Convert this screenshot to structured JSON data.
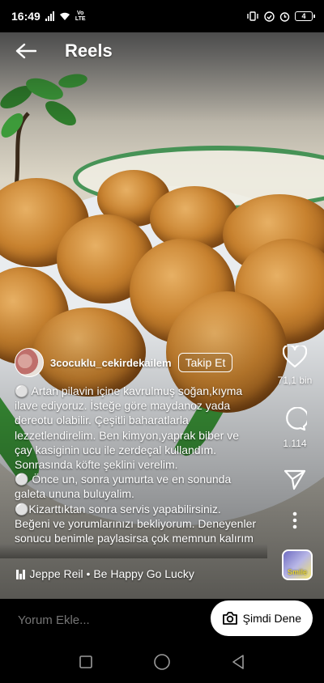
{
  "status_bar": {
    "time": "16:49",
    "volte": "Vo",
    "lte": "LTE",
    "battery": "4"
  },
  "header": {
    "title": "Reels"
  },
  "author": {
    "username": "3cocuklu_cekirdekailem",
    "follow_label": "Takip Et"
  },
  "caption": {
    "lines": [
      "⚪ Artan pilavin içine kavrulmuş soğan,kıyma ilave ediyoruz. İsteğe göre maydanoz yada dereotu olabilir. Çeşitli baharatlarla lezzetlendirelim. Ben kimyon,yaprak biber ve çay kasiginin ucu ile zerdeçal kullandım. Sonrasında köfte şeklini verelim.",
      "⚪ Önce un, sonra yumurta ve en sonunda galeta ununa buluyalim.",
      "⚪Kizarttıktan sonra servis yapabilirsiniz. Beğeni ve yorumlarınızı bekliyorum. Deneyenler sonucu benimle paylasirsa çok memnun kalırım"
    ]
  },
  "actions": {
    "likes": "71,1 bin",
    "comments": "1.114"
  },
  "music": {
    "text": "Jeppe Reil • Be Happy Go Lucky",
    "thumb_label": "Smile"
  },
  "bottom": {
    "comment_placeholder": "Yorum Ekle...",
    "try_label": "Şimdi Dene"
  },
  "colors": {
    "background": "#000000",
    "button_bg": "#ffffff",
    "placeholder": "#a8a8a8",
    "accent_plant": "#3d9b3a"
  }
}
